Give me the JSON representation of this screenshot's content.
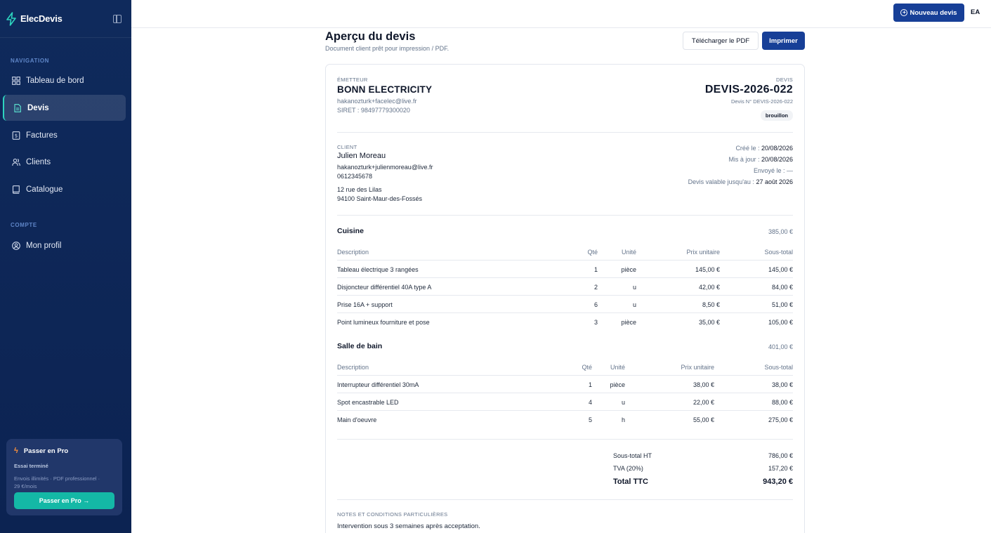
{
  "app": {
    "name": "ElecDevis"
  },
  "sidebar": {
    "navigation_title": "NAVIGATION",
    "items": [
      {
        "label": "Tableau de bord",
        "icon": "dashboard-icon"
      },
      {
        "label": "Devis",
        "icon": "document-icon",
        "active": true
      },
      {
        "label": "Factures",
        "icon": "invoice-icon"
      },
      {
        "label": "Clients",
        "icon": "users-icon"
      },
      {
        "label": "Catalogue",
        "icon": "book-icon"
      }
    ],
    "account_title": "COMPTE",
    "account_items": [
      {
        "label": "Mon profil",
        "icon": "user-circle-icon"
      }
    ],
    "pro": {
      "title": "Passer en Pro",
      "status": "Essai terminé",
      "desc_line1": "Envois illimités · PDF professionnel ·",
      "desc_line2": "29 €/mois",
      "button": "Passer en Pro →"
    }
  },
  "topbar": {
    "new_button": "Nouveau devis",
    "user_initials": "EA"
  },
  "page": {
    "title": "Aperçu du devis",
    "subtitle": "Document client prêt pour impression / PDF.",
    "download_button": "Télécharger le PDF",
    "print_button": "Imprimer"
  },
  "quote": {
    "issuer_label": "ÉMETTEUR",
    "issuer_name": "BONN ELECTRICITY",
    "issuer_email": "hakanozturk+facelec@live.fr",
    "issuer_siret": "SIRET : 98497779300020",
    "type_label": "DEVIS",
    "number": "DEVIS-2026-022",
    "number_sub": "Devis N° DEVIS-2026-022",
    "status": "brouillon",
    "client_label": "CLIENT",
    "client_name": "Julien Moreau",
    "client_email": "hakanozturk+julienmoreau@live.fr",
    "client_phone": "0612345678",
    "client_address1": "12 rue des Lilas",
    "client_address2": "94100 Saint-Maur-des-Fossés",
    "dates": {
      "created_label": "Créé le : ",
      "created": "20/08/2026",
      "updated_label": "Mis à jour : ",
      "updated": "20/08/2026",
      "sent": "Envoyé le : —",
      "valid_label": "Devis valable jusqu'au : ",
      "valid": "27 août 2026"
    },
    "columns": [
      "Description",
      "Qté",
      "Unité",
      "Prix unitaire",
      "Sous-total"
    ],
    "sections": [
      {
        "name": "Cuisine",
        "total": "385,00 €",
        "rows": [
          [
            "Tableau électrique 3 rangées",
            "1",
            "pièce",
            "145,00 €",
            "145,00 €"
          ],
          [
            "Disjoncteur différentiel 40A type A",
            "2",
            "u",
            "42,00 €",
            "84,00 €"
          ],
          [
            "Prise 16A + support",
            "6",
            "u",
            "8,50 €",
            "51,00 €"
          ],
          [
            "Point lumineux fourniture et pose",
            "3",
            "pièce",
            "35,00 €",
            "105,00 €"
          ]
        ]
      },
      {
        "name": "Salle de bain",
        "total": "401,00 €",
        "rows": [
          [
            "Interrupteur différentiel 30mA",
            "1",
            "pièce",
            "38,00 €",
            "38,00 €"
          ],
          [
            "Spot encastrable LED",
            "4",
            "u",
            "22,00 €",
            "88,00 €"
          ],
          [
            "Main d'oeuvre",
            "5",
            "h",
            "55,00 €",
            "275,00 €"
          ]
        ]
      }
    ],
    "totals": {
      "subtotal_label": "Sous-total HT",
      "subtotal": "786,00 €",
      "tax_label": "TVA (20%)",
      "tax": "157,20 €",
      "total_label": "Total TTC",
      "total": "943,20 €"
    },
    "notes_title": "NOTES ET CONDITIONS PARTICULIÈRES",
    "notes": "Intervention sous 3 semaines après acceptation."
  }
}
